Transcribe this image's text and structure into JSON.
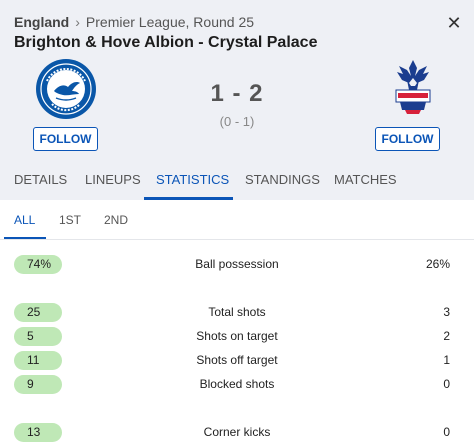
{
  "header": {
    "country": "England",
    "competition": "Premier League, Round 25",
    "close_symbol": "✕",
    "title": "Brighton & Hove Albion - Crystal Palace"
  },
  "match": {
    "home_team": "Brighton & Hove Albion",
    "away_team": "Crystal Palace",
    "score": "1 - 2",
    "halftime": "(0 - 1)",
    "home_logo_text": "BRIGHTON & HOVE ALBION",
    "away_logo_text": "CRYSTAL PALACE F.C.",
    "follow_label": "FOLLOW"
  },
  "tabs": [
    "DETAILS",
    "LINEUPS",
    "STATISTICS",
    "STANDINGS",
    "MATCHES"
  ],
  "active_tab": "STATISTICS",
  "subtabs": [
    "ALL",
    "1ST",
    "2ND"
  ],
  "active_subtab": "ALL",
  "stats": [
    {
      "home": "74%",
      "label": "Ball possession",
      "away": "26%"
    },
    {
      "home": "25",
      "label": "Total shots",
      "away": "3"
    },
    {
      "home": "5",
      "label": "Shots on target",
      "away": "2"
    },
    {
      "home": "11",
      "label": "Shots off target",
      "away": "1"
    },
    {
      "home": "9",
      "label": "Blocked shots",
      "away": "0"
    },
    {
      "home": "13",
      "label": "Corner kicks",
      "away": "0"
    }
  ],
  "colors": {
    "accent": "#0b55b7",
    "pill": "#bfe8b6",
    "header_bg": "#eef0f5",
    "brighton_blue": "#0a57a8",
    "palace_red": "#d7213a"
  }
}
